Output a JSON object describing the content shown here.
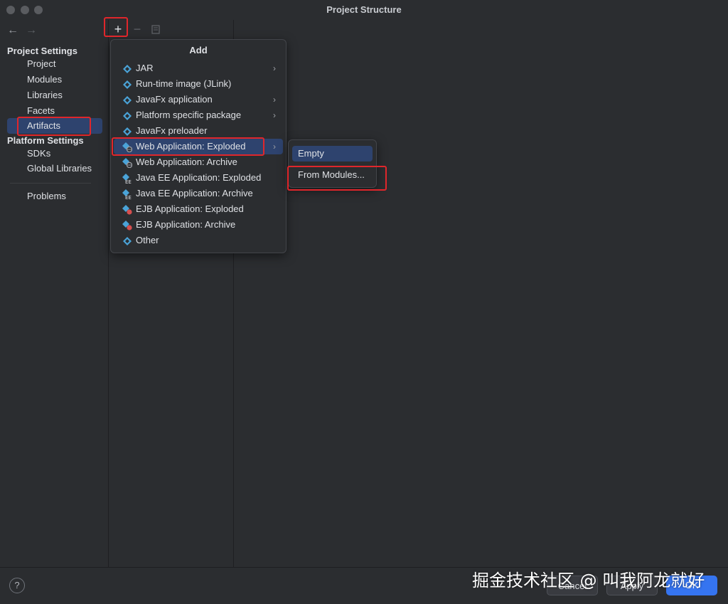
{
  "window": {
    "title": "Project Structure"
  },
  "nav": {
    "back_icon": "←",
    "forward_icon": "→"
  },
  "sidebar": {
    "project_settings_header": "Project Settings",
    "project_items": [
      "Project",
      "Modules",
      "Libraries",
      "Facets",
      "Artifacts"
    ],
    "selected": "Artifacts",
    "platform_settings_header": "Platform Settings",
    "platform_items": [
      "SDKs",
      "Global Libraries"
    ],
    "problems": "Problems"
  },
  "toolbar": {
    "add_icon": "+",
    "remove_icon": "−",
    "copy_icon": "copy-icon"
  },
  "add_menu": {
    "title": "Add",
    "items": [
      {
        "label": "JAR",
        "icon": "artifact-icon",
        "submenu": true
      },
      {
        "label": "Run-time image (JLink)",
        "icon": "artifact-icon",
        "submenu": false
      },
      {
        "label": "JavaFx application",
        "icon": "artifact-icon",
        "submenu": true
      },
      {
        "label": "Platform specific package",
        "icon": "artifact-icon",
        "submenu": true
      },
      {
        "label": "JavaFx preloader",
        "icon": "artifact-icon",
        "submenu": false
      },
      {
        "label": "Web Application: Exploded",
        "icon": "web-artifact-icon",
        "submenu": true,
        "selected": true
      },
      {
        "label": "Web Application: Archive",
        "icon": "web-artifact-icon",
        "submenu": false
      },
      {
        "label": "Java EE Application: Exploded",
        "icon": "javaee-artifact-icon",
        "submenu": false
      },
      {
        "label": "Java EE Application: Archive",
        "icon": "javaee-artifact-icon",
        "submenu": false
      },
      {
        "label": "EJB Application: Exploded",
        "icon": "ejb-artifact-icon",
        "submenu": false
      },
      {
        "label": "EJB Application: Archive",
        "icon": "ejb-artifact-icon",
        "submenu": false
      },
      {
        "label": "Other",
        "icon": "artifact-icon",
        "submenu": false
      }
    ]
  },
  "submenu": {
    "items": [
      "Empty",
      "From Modules..."
    ],
    "selected": "Empty"
  },
  "buttons": {
    "cancel": "Cancel",
    "apply": "Apply",
    "ok": "OK",
    "help": "?"
  },
  "watermark": "掘金技术社区 @ 叫我阿龙就好",
  "colors": {
    "selection": "#2e436e",
    "highlight": "#e0262b",
    "primary": "#3574f0",
    "icon_blue": "#4aa3d8"
  }
}
